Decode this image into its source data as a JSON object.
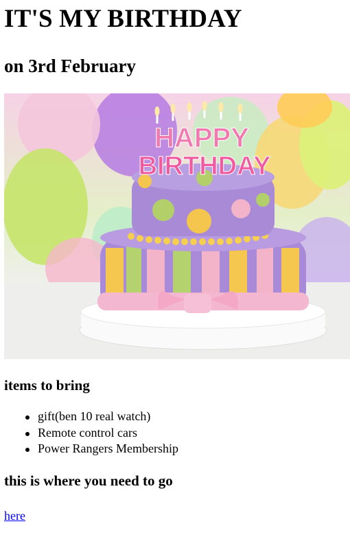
{
  "heading": {
    "title": "IT'S MY BIRTHDAY",
    "subtitle": "on 3rd February"
  },
  "hero": {
    "topper_line1": "HAPPY",
    "topper_line2": "BIRTHDAY"
  },
  "items_section": {
    "heading": "items to bring",
    "items": [
      "gift(ben 10 real watch)",
      "Remote control cars",
      "Power Rangers Membership"
    ]
  },
  "directions": {
    "heading": "this is where you need to go",
    "link_text": "here"
  }
}
